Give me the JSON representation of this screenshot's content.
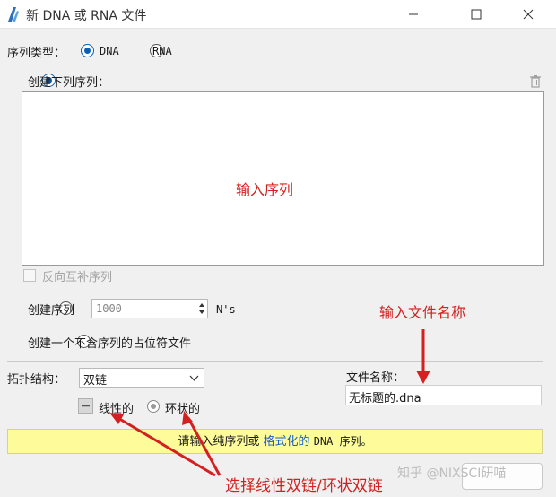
{
  "window": {
    "title": "新 DNA 或 RNA 文件"
  },
  "sequence_type": {
    "label": "序列类型：",
    "options": [
      "DNA",
      "RNA"
    ],
    "selected": "DNA"
  },
  "mode_create_below": {
    "label": "创建下列序列：",
    "selected": true
  },
  "sequence_input": {
    "value": ""
  },
  "reverse_complement": {
    "label": "反向互补序列",
    "checked": false
  },
  "mode_create_n": {
    "label": "创建序列",
    "value": "1000",
    "unit": "N's"
  },
  "mode_placeholder": {
    "label": "创建一个不含序列的占位符文件"
  },
  "topology": {
    "label": "拓扑结构：",
    "selected": "双链",
    "options": [
      "线性的",
      "环状的"
    ]
  },
  "file_name": {
    "label": "文件名称：",
    "value": "无标题的.dna"
  },
  "status": {
    "prefix": "请输入纯序列或",
    "link": "格式化的",
    "suffix": "DNA 序列。"
  },
  "annotations": {
    "input_sequence": "输入序列",
    "input_filename": "输入文件名称",
    "choose_topology": "选择线性双链/环状双链"
  },
  "watermark": "知乎 @NIXSCI研喵",
  "colors": {
    "accent": "#0a5fb4",
    "annotation": "#d42020",
    "status_bg": "#fdfb9a",
    "link": "#1a5ccc"
  }
}
